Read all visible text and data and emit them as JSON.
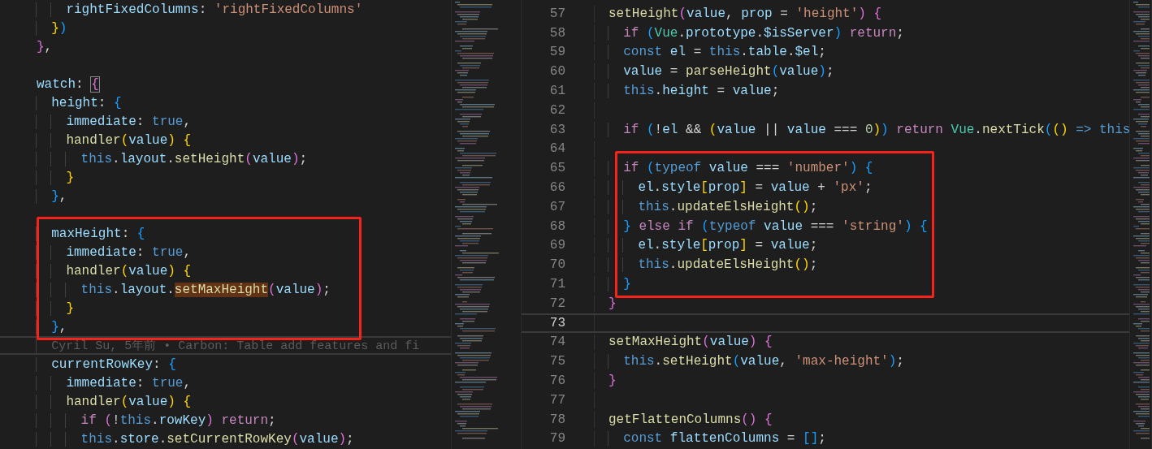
{
  "editors": [
    {
      "lines": [
        {
          "current": false,
          "framed": false,
          "tokens": [
            {
              "text": "    rightFixedColumns",
              "kind": "var"
            },
            {
              "text": ": ",
              "kind": "punc"
            },
            {
              "text": "'rightFixedColumns'",
              "kind": "str"
            }
          ]
        },
        {
          "current": false,
          "framed": false,
          "tokens": [
            {
              "text": "  }",
              "kind": "b1"
            },
            {
              "text": ")",
              "kind": "b3"
            }
          ]
        },
        {
          "current": false,
          "framed": false,
          "tokens": [
            {
              "text": "}",
              "kind": "b2"
            },
            {
              "text": ",",
              "kind": "punc"
            }
          ]
        },
        {
          "current": false,
          "framed": false
        },
        {
          "current": false,
          "framed": false,
          "tokens": [
            {
              "text": "watch",
              "kind": "var"
            },
            {
              "text": ": ",
              "kind": "punc"
            },
            {
              "text": "{",
              "kind": "b2",
              "boxed": true
            }
          ]
        },
        {
          "current": false,
          "framed": false,
          "tokens": [
            {
              "text": "  height",
              "kind": "var"
            },
            {
              "text": ": ",
              "kind": "punc"
            },
            {
              "text": "{",
              "kind": "b3"
            }
          ]
        },
        {
          "current": false,
          "framed": false,
          "tokens": [
            {
              "text": "    immediate",
              "kind": "var"
            },
            {
              "text": ": ",
              "kind": "punc"
            },
            {
              "text": "true",
              "kind": "storage"
            },
            {
              "text": ",",
              "kind": "punc"
            }
          ]
        },
        {
          "current": false,
          "framed": false,
          "tokens": [
            {
              "text": "    handler",
              "kind": "fn"
            },
            {
              "text": "(",
              "kind": "b1"
            },
            {
              "text": "value",
              "kind": "var"
            },
            {
              "text": ")",
              "kind": "b1"
            },
            {
              "text": " {",
              "kind": "b1"
            }
          ]
        },
        {
          "current": false,
          "framed": false,
          "tokens": [
            {
              "text": "      this",
              "kind": "storage"
            },
            {
              "text": ".",
              "kind": "punc"
            },
            {
              "text": "layout",
              "kind": "var"
            },
            {
              "text": ".",
              "kind": "punc"
            },
            {
              "text": "setHeight",
              "kind": "fn"
            },
            {
              "text": "(",
              "kind": "b2"
            },
            {
              "text": "value",
              "kind": "var"
            },
            {
              "text": ")",
              "kind": "b2"
            },
            {
              "text": ";",
              "kind": "punc"
            }
          ]
        },
        {
          "current": false,
          "framed": false,
          "tokens": [
            {
              "text": "    }",
              "kind": "b1"
            }
          ]
        },
        {
          "current": false,
          "framed": false,
          "tokens": [
            {
              "text": "  }",
              "kind": "b3"
            },
            {
              "text": ",",
              "kind": "punc"
            }
          ]
        },
        {
          "current": false,
          "framed": false
        },
        {
          "current": false,
          "framed": true,
          "tokens": [
            {
              "text": "  maxHeight",
              "kind": "var"
            },
            {
              "text": ": ",
              "kind": "punc"
            },
            {
              "text": "{",
              "kind": "b3"
            }
          ]
        },
        {
          "current": false,
          "framed": true,
          "tokens": [
            {
              "text": "    immediate",
              "kind": "var"
            },
            {
              "text": ": ",
              "kind": "punc"
            },
            {
              "text": "true",
              "kind": "storage"
            },
            {
              "text": ",",
              "kind": "punc"
            }
          ]
        },
        {
          "current": false,
          "framed": true,
          "tokens": [
            {
              "text": "    handler",
              "kind": "fn"
            },
            {
              "text": "(",
              "kind": "b1"
            },
            {
              "text": "value",
              "kind": "var"
            },
            {
              "text": ")",
              "kind": "b1"
            },
            {
              "text": " {",
              "kind": "b1"
            }
          ]
        },
        {
          "current": false,
          "framed": true,
          "tokens": [
            {
              "text": "      this",
              "kind": "storage"
            },
            {
              "text": ".",
              "kind": "punc"
            },
            {
              "text": "layout",
              "kind": "var"
            },
            {
              "text": ".",
              "kind": "punc"
            },
            {
              "text": "setMaxHeight",
              "kind": "fn",
              "highlighted": true
            },
            {
              "text": "(",
              "kind": "b2"
            },
            {
              "text": "value",
              "kind": "var"
            },
            {
              "text": ")",
              "kind": "b2"
            },
            {
              "text": ";",
              "kind": "punc"
            }
          ]
        },
        {
          "current": false,
          "framed": true,
          "tokens": [
            {
              "text": "    }",
              "kind": "b1"
            }
          ]
        },
        {
          "current": false,
          "framed": true,
          "tokens": [
            {
              "text": "  }",
              "kind": "b3"
            },
            {
              "text": ",",
              "kind": "punc"
            }
          ]
        },
        {
          "current": true,
          "framed": false,
          "blame": "  Cyril Su, 5年前 • Carbon: Table add features and fi"
        },
        {
          "current": false,
          "framed": false,
          "tokens": [
            {
              "text": "  currentRowKey",
              "kind": "var"
            },
            {
              "text": ": ",
              "kind": "punc"
            },
            {
              "text": "{",
              "kind": "b3"
            }
          ]
        },
        {
          "current": false,
          "framed": false,
          "tokens": [
            {
              "text": "    immediate",
              "kind": "var"
            },
            {
              "text": ": ",
              "kind": "punc"
            },
            {
              "text": "true",
              "kind": "storage"
            },
            {
              "text": ",",
              "kind": "punc"
            }
          ]
        },
        {
          "current": false,
          "framed": false,
          "tokens": [
            {
              "text": "    handler",
              "kind": "fn"
            },
            {
              "text": "(",
              "kind": "b1"
            },
            {
              "text": "value",
              "kind": "var"
            },
            {
              "text": ")",
              "kind": "b1"
            },
            {
              "text": " {",
              "kind": "b1"
            }
          ]
        },
        {
          "current": false,
          "framed": false,
          "tokens": [
            {
              "text": "      if",
              "kind": "kw"
            },
            {
              "text": " (",
              "kind": "b2"
            },
            {
              "text": "!",
              "kind": "punc"
            },
            {
              "text": "this",
              "kind": "storage"
            },
            {
              "text": ".",
              "kind": "punc"
            },
            {
              "text": "rowKey",
              "kind": "var"
            },
            {
              "text": ")",
              "kind": "b2"
            },
            {
              "text": " return",
              "kind": "kw"
            },
            {
              "text": ";",
              "kind": "punc"
            }
          ]
        },
        {
          "current": false,
          "framed": false,
          "tokens": [
            {
              "text": "      this",
              "kind": "storage"
            },
            {
              "text": ".",
              "kind": "punc"
            },
            {
              "text": "store",
              "kind": "var"
            },
            {
              "text": ".",
              "kind": "punc"
            },
            {
              "text": "setCurrentRowKey",
              "kind": "fn"
            },
            {
              "text": "(",
              "kind": "b2"
            },
            {
              "text": "value",
              "kind": "var"
            },
            {
              "text": ")",
              "kind": "b2"
            },
            {
              "text": ";",
              "kind": "punc"
            }
          ]
        }
      ]
    },
    {
      "lines": [
        {
          "number": "57",
          "current": false,
          "framed": false,
          "tokens": [
            {
              "text": "setHeight",
              "kind": "fn"
            },
            {
              "text": "(",
              "kind": "b2"
            },
            {
              "text": "value",
              "kind": "var"
            },
            {
              "text": ", ",
              "kind": "punc"
            },
            {
              "text": "prop",
              "kind": "var"
            },
            {
              "text": " = ",
              "kind": "punc"
            },
            {
              "text": "'height'",
              "kind": "str"
            },
            {
              "text": ")",
              "kind": "b2"
            },
            {
              "text": " {",
              "kind": "b2"
            }
          ]
        },
        {
          "number": "58",
          "current": false,
          "framed": false,
          "tokens": [
            {
              "text": "  if",
              "kind": "kw"
            },
            {
              "text": " (",
              "kind": "b3"
            },
            {
              "text": "Vue",
              "kind": "type"
            },
            {
              "text": ".",
              "kind": "punc"
            },
            {
              "text": "prototype",
              "kind": "var"
            },
            {
              "text": ".",
              "kind": "punc"
            },
            {
              "text": "$isServer",
              "kind": "var"
            },
            {
              "text": ")",
              "kind": "b3"
            },
            {
              "text": " return",
              "kind": "kw"
            },
            {
              "text": ";",
              "kind": "punc"
            }
          ]
        },
        {
          "number": "59",
          "current": false,
          "framed": false,
          "tokens": [
            {
              "text": "  const",
              "kind": "storage"
            },
            {
              "text": " el",
              "kind": "var"
            },
            {
              "text": " = ",
              "kind": "punc"
            },
            {
              "text": "this",
              "kind": "storage"
            },
            {
              "text": ".",
              "kind": "punc"
            },
            {
              "text": "table",
              "kind": "var"
            },
            {
              "text": ".",
              "kind": "punc"
            },
            {
              "text": "$el",
              "kind": "var"
            },
            {
              "text": ";",
              "kind": "punc"
            }
          ]
        },
        {
          "number": "60",
          "current": false,
          "framed": false,
          "tokens": [
            {
              "text": "  value",
              "kind": "var"
            },
            {
              "text": " = ",
              "kind": "punc"
            },
            {
              "text": "parseHeight",
              "kind": "fn"
            },
            {
              "text": "(",
              "kind": "b3"
            },
            {
              "text": "value",
              "kind": "var"
            },
            {
              "text": ")",
              "kind": "b3"
            },
            {
              "text": ";",
              "kind": "punc"
            }
          ]
        },
        {
          "number": "61",
          "current": false,
          "framed": false,
          "tokens": [
            {
              "text": "  this",
              "kind": "storage"
            },
            {
              "text": ".",
              "kind": "punc"
            },
            {
              "text": "height",
              "kind": "var"
            },
            {
              "text": " = ",
              "kind": "punc"
            },
            {
              "text": "value",
              "kind": "var"
            },
            {
              "text": ";",
              "kind": "punc"
            }
          ]
        },
        {
          "number": "62",
          "current": false,
          "framed": false
        },
        {
          "number": "63",
          "current": false,
          "framed": false,
          "tokens": [
            {
              "text": "  if",
              "kind": "kw"
            },
            {
              "text": " (",
              "kind": "b3"
            },
            {
              "text": "!",
              "kind": "punc"
            },
            {
              "text": "el",
              "kind": "var"
            },
            {
              "text": " && ",
              "kind": "punc"
            },
            {
              "text": "(",
              "kind": "b1"
            },
            {
              "text": "value",
              "kind": "var"
            },
            {
              "text": " || ",
              "kind": "punc"
            },
            {
              "text": "value",
              "kind": "var"
            },
            {
              "text": " === ",
              "kind": "punc"
            },
            {
              "text": "0",
              "kind": "num"
            },
            {
              "text": ")",
              "kind": "b1"
            },
            {
              "text": ")",
              "kind": "b3"
            },
            {
              "text": " return",
              "kind": "kw"
            },
            {
              "text": " Vue",
              "kind": "type"
            },
            {
              "text": ".",
              "kind": "punc"
            },
            {
              "text": "nextTick",
              "kind": "fn"
            },
            {
              "text": "(",
              "kind": "b3"
            },
            {
              "text": "()",
              "kind": "b1"
            },
            {
              "text": " =>",
              "kind": "storage"
            },
            {
              "text": " this",
              "kind": "storage"
            }
          ]
        },
        {
          "number": "64",
          "current": false,
          "framed": false
        },
        {
          "number": "65",
          "current": false,
          "framed": true,
          "tokens": [
            {
              "text": "  if",
              "kind": "kw"
            },
            {
              "text": " (",
              "kind": "b3"
            },
            {
              "text": "typeof",
              "kind": "storage"
            },
            {
              "text": " value",
              "kind": "var"
            },
            {
              "text": " === ",
              "kind": "punc"
            },
            {
              "text": "'number'",
              "kind": "str"
            },
            {
              "text": ")",
              "kind": "b3"
            },
            {
              "text": " {",
              "kind": "b3"
            }
          ]
        },
        {
          "number": "66",
          "current": false,
          "framed": true,
          "tokens": [
            {
              "text": "    el",
              "kind": "var"
            },
            {
              "text": ".",
              "kind": "punc"
            },
            {
              "text": "style",
              "kind": "var"
            },
            {
              "text": "[",
              "kind": "b1"
            },
            {
              "text": "prop",
              "kind": "var"
            },
            {
              "text": "]",
              "kind": "b1"
            },
            {
              "text": " = ",
              "kind": "punc"
            },
            {
              "text": "value",
              "kind": "var"
            },
            {
              "text": " + ",
              "kind": "punc"
            },
            {
              "text": "'px'",
              "kind": "str"
            },
            {
              "text": ";",
              "kind": "punc"
            }
          ]
        },
        {
          "number": "67",
          "current": false,
          "framed": true,
          "tokens": [
            {
              "text": "    this",
              "kind": "storage"
            },
            {
              "text": ".",
              "kind": "punc"
            },
            {
              "text": "updateElsHeight",
              "kind": "fn"
            },
            {
              "text": "()",
              "kind": "b1"
            },
            {
              "text": ";",
              "kind": "punc"
            }
          ]
        },
        {
          "number": "68",
          "current": false,
          "framed": true,
          "tokens": [
            {
              "text": "  }",
              "kind": "b3"
            },
            {
              "text": " else if",
              "kind": "kw"
            },
            {
              "text": " (",
              "kind": "b3"
            },
            {
              "text": "typeof",
              "kind": "storage"
            },
            {
              "text": " value",
              "kind": "var"
            },
            {
              "text": " === ",
              "kind": "punc"
            },
            {
              "text": "'string'",
              "kind": "str"
            },
            {
              "text": ")",
              "kind": "b3"
            },
            {
              "text": " {",
              "kind": "b3"
            }
          ]
        },
        {
          "number": "69",
          "current": false,
          "framed": true,
          "tokens": [
            {
              "text": "    el",
              "kind": "var"
            },
            {
              "text": ".",
              "kind": "punc"
            },
            {
              "text": "style",
              "kind": "var"
            },
            {
              "text": "[",
              "kind": "b1"
            },
            {
              "text": "prop",
              "kind": "var"
            },
            {
              "text": "]",
              "kind": "b1"
            },
            {
              "text": " = ",
              "kind": "punc"
            },
            {
              "text": "value",
              "kind": "var"
            },
            {
              "text": ";",
              "kind": "punc"
            }
          ]
        },
        {
          "number": "70",
          "current": false,
          "framed": true,
          "tokens": [
            {
              "text": "    this",
              "kind": "storage"
            },
            {
              "text": ".",
              "kind": "punc"
            },
            {
              "text": "updateElsHeight",
              "kind": "fn"
            },
            {
              "text": "()",
              "kind": "b1"
            },
            {
              "text": ";",
              "kind": "punc"
            }
          ]
        },
        {
          "number": "71",
          "current": false,
          "framed": true,
          "tokens": [
            {
              "text": "  }",
              "kind": "b3"
            }
          ]
        },
        {
          "number": "72",
          "current": false,
          "framed": false,
          "tokens": [
            {
              "text": "}",
              "kind": "b2"
            }
          ]
        },
        {
          "number": "73",
          "current": true,
          "framed": false
        },
        {
          "number": "74",
          "current": false,
          "framed": false,
          "tokens": [
            {
              "text": "setMaxHeight",
              "kind": "fn"
            },
            {
              "text": "(",
              "kind": "b2"
            },
            {
              "text": "value",
              "kind": "var"
            },
            {
              "text": ")",
              "kind": "b2"
            },
            {
              "text": " {",
              "kind": "b2"
            }
          ]
        },
        {
          "number": "75",
          "current": false,
          "framed": false,
          "tokens": [
            {
              "text": "  this",
              "kind": "storage"
            },
            {
              "text": ".",
              "kind": "punc"
            },
            {
              "text": "setHeight",
              "kind": "fn"
            },
            {
              "text": "(",
              "kind": "b3"
            },
            {
              "text": "value",
              "kind": "var"
            },
            {
              "text": ", ",
              "kind": "punc"
            },
            {
              "text": "'max-height'",
              "kind": "str"
            },
            {
              "text": ")",
              "kind": "b3"
            },
            {
              "text": ";",
              "kind": "punc"
            }
          ]
        },
        {
          "number": "76",
          "current": false,
          "framed": false,
          "tokens": [
            {
              "text": "}",
              "kind": "b2"
            }
          ]
        },
        {
          "number": "77",
          "current": false,
          "framed": false
        },
        {
          "number": "78",
          "current": false,
          "framed": false,
          "tokens": [
            {
              "text": "getFlattenColumns",
              "kind": "fn"
            },
            {
              "text": "()",
              "kind": "b2"
            },
            {
              "text": " {",
              "kind": "b2"
            }
          ]
        },
        {
          "number": "79",
          "current": false,
          "framed": false,
          "tokens": [
            {
              "text": "  const",
              "kind": "storage"
            },
            {
              "text": " flattenColumns",
              "kind": "var"
            },
            {
              "text": " = ",
              "kind": "punc"
            },
            {
              "text": "[]",
              "kind": "b3"
            },
            {
              "text": ";",
              "kind": "punc"
            }
          ]
        }
      ]
    }
  ]
}
